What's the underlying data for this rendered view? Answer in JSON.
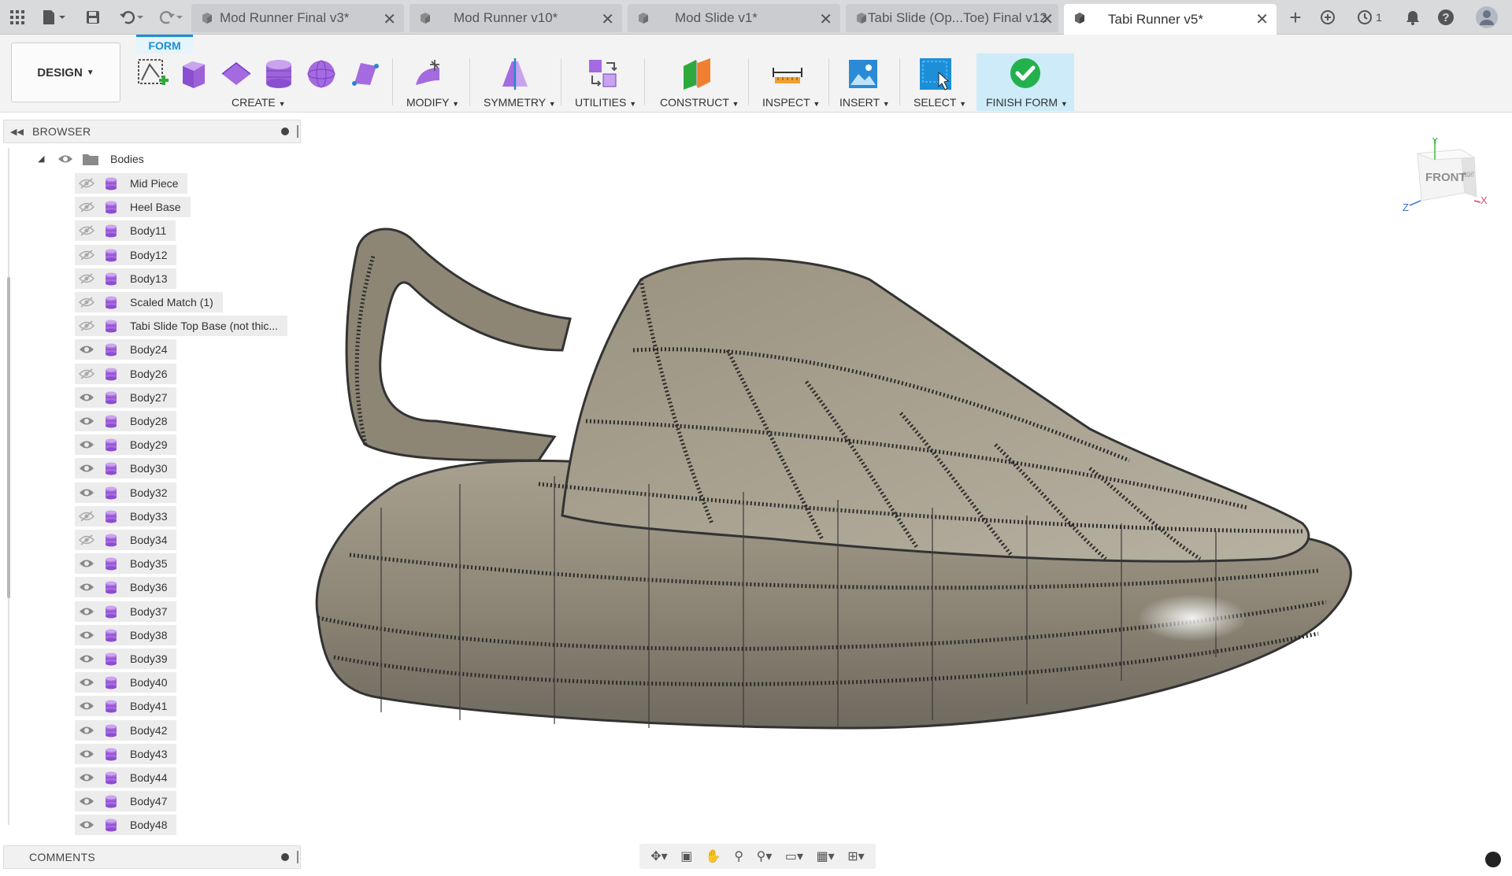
{
  "tabs": [
    {
      "label": "Mod Runner Final v3*"
    },
    {
      "label": "Mod Runner v10*"
    },
    {
      "label": "Mod Slide v1*"
    },
    {
      "label": "Tabi Slide (Op...Toe) Final v12"
    },
    {
      "label": "Tabi Runner v5*"
    }
  ],
  "jobs_count": "1",
  "toolbar": {
    "workspace": "DESIGN",
    "active_tab": "FORM",
    "groups": {
      "create": "CREATE",
      "modify": "MODIFY",
      "symmetry": "SYMMETRY",
      "utilities": "UTILITIES",
      "construct": "CONSTRUCT",
      "inspect": "INSPECT",
      "insert": "INSERT",
      "select": "SELECT",
      "finish": "FINISH FORM"
    }
  },
  "browser": {
    "title": "BROWSER",
    "folder": "Bodies",
    "bodies": [
      {
        "name": "Mid Piece",
        "visible": false
      },
      {
        "name": "Heel Base",
        "visible": false
      },
      {
        "name": "Body11",
        "visible": false
      },
      {
        "name": "Body12",
        "visible": false
      },
      {
        "name": "Body13",
        "visible": false
      },
      {
        "name": "Scaled Match (1)",
        "visible": false
      },
      {
        "name": "Tabi Slide Top Base (not thic...",
        "visible": false
      },
      {
        "name": "Body24",
        "visible": true
      },
      {
        "name": "Body26",
        "visible": false
      },
      {
        "name": "Body27",
        "visible": true
      },
      {
        "name": "Body28",
        "visible": true
      },
      {
        "name": "Body29",
        "visible": true
      },
      {
        "name": "Body30",
        "visible": true
      },
      {
        "name": "Body32",
        "visible": true
      },
      {
        "name": "Body33",
        "visible": false
      },
      {
        "name": "Body34",
        "visible": false
      },
      {
        "name": "Body35",
        "visible": true
      },
      {
        "name": "Body36",
        "visible": true
      },
      {
        "name": "Body37",
        "visible": true
      },
      {
        "name": "Body38",
        "visible": true
      },
      {
        "name": "Body39",
        "visible": true
      },
      {
        "name": "Body40",
        "visible": true
      },
      {
        "name": "Body41",
        "visible": true
      },
      {
        "name": "Body42",
        "visible": true
      },
      {
        "name": "Body43",
        "visible": true
      },
      {
        "name": "Body44",
        "visible": true
      },
      {
        "name": "Body47",
        "visible": true
      },
      {
        "name": "Body48",
        "visible": true
      }
    ]
  },
  "comments": {
    "title": "COMMENTS"
  },
  "viewcube": {
    "front": "FRONT",
    "right": "RIGHT",
    "x": "X",
    "y": "Y",
    "z": "Z"
  },
  "colors": {
    "accent": "#1a8fd6",
    "body_icon": "#a96ae0",
    "finish_bg": "#cdebf8",
    "finish_check": "#22b14c"
  }
}
